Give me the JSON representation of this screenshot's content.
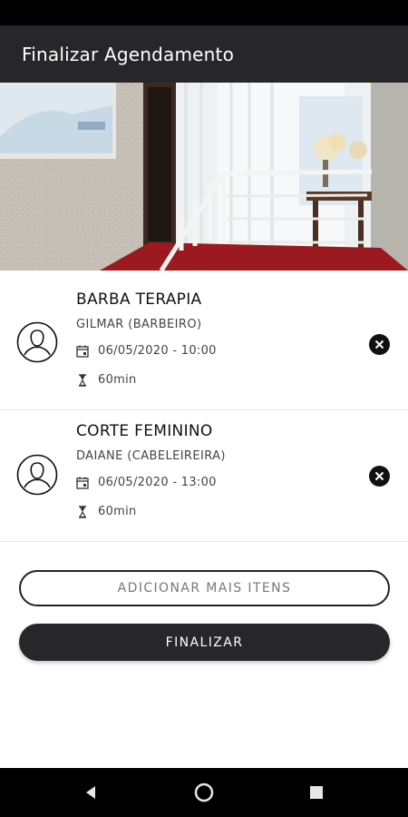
{
  "header": {
    "title": "Finalizar Agendamento"
  },
  "items": [
    {
      "service": "BARBA TERAPIA",
      "professional": "GILMAR (BARBEIRO)",
      "datetime": "06/05/2020 - 10:00",
      "duration": "60min"
    },
    {
      "service": "CORTE FEMININO",
      "professional": "DAIANE (CABELEIREIRA)",
      "datetime": "06/05/2020 - 13:00",
      "duration": "60min"
    }
  ],
  "actions": {
    "add_label": "ADICIONAR MAIS ITENS",
    "finish_label": "FINALIZAR"
  },
  "icons": {
    "avatar": "user-avatar-icon",
    "calendar": "calendar-icon",
    "duration": "hourglass-icon",
    "remove": "close-circle-icon"
  },
  "colors": {
    "app_bar": "#27272b",
    "primary_button": "#27272b",
    "background": "#ffffff"
  }
}
